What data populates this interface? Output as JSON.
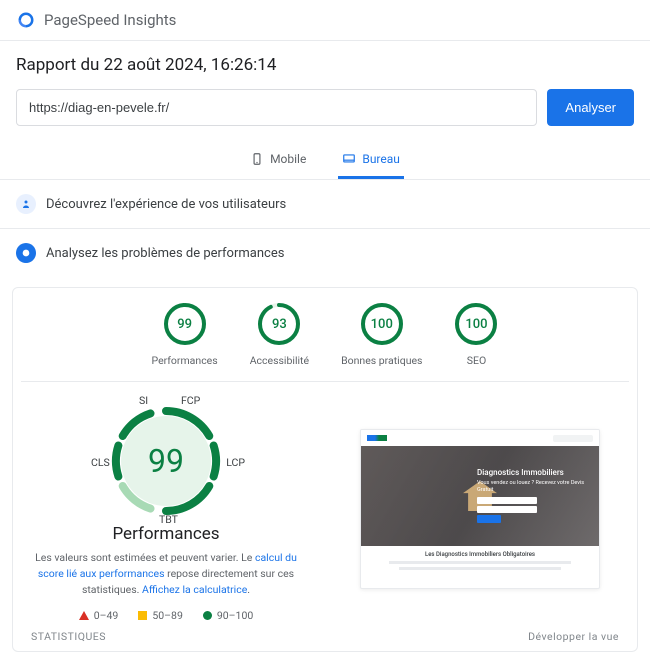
{
  "header": {
    "product": "PageSpeed Insights"
  },
  "report": {
    "title": "Rapport du 22 août 2024, 16:26:14",
    "url_value": "https://diag-en-pevele.fr/",
    "analyze_label": "Analyser"
  },
  "tabs": {
    "mobile": "Mobile",
    "desktop": "Bureau",
    "active": "desktop"
  },
  "sections": {
    "users": "Découvrez l'expérience de vos utilisateurs",
    "diagnose": "Analysez les problèmes de performances"
  },
  "scores": [
    {
      "label": "Performances",
      "value": 99,
      "arc": 99
    },
    {
      "label": "Accessibilité",
      "value": 93,
      "arc": 93
    },
    {
      "label": "Bonnes pratiques",
      "value": 100,
      "arc": 100
    },
    {
      "label": "SEO",
      "value": 100,
      "arc": 100
    }
  ],
  "gauge": {
    "value": 99,
    "name": "Performances",
    "metrics": {
      "si": "SI",
      "fcp": "FCP",
      "cls": "CLS",
      "lcp": "LCP",
      "tbt": "TBT"
    }
  },
  "disclaimer": {
    "prefix": "Les valeurs sont estimées et peuvent varier. Le ",
    "link1": "calcul du score lié aux performances",
    "mid": " repose directement sur ces statistiques. ",
    "link2": "Affichez la calculatrice",
    "suffix": "."
  },
  "legend": {
    "bad": "0–49",
    "mid": "50–89",
    "good": "90–100"
  },
  "screenshot": {
    "hero_title": "Diagnostics Immobiliers",
    "hero_sub": "Vous vendez ou louez ?\nRecevez votre Devis Gratuit",
    "body_title": "Les Diagnostics Immobiliers Obligatoires"
  },
  "footer": {
    "stats": "STATISTIQUES",
    "expand": "Développer la vue"
  }
}
